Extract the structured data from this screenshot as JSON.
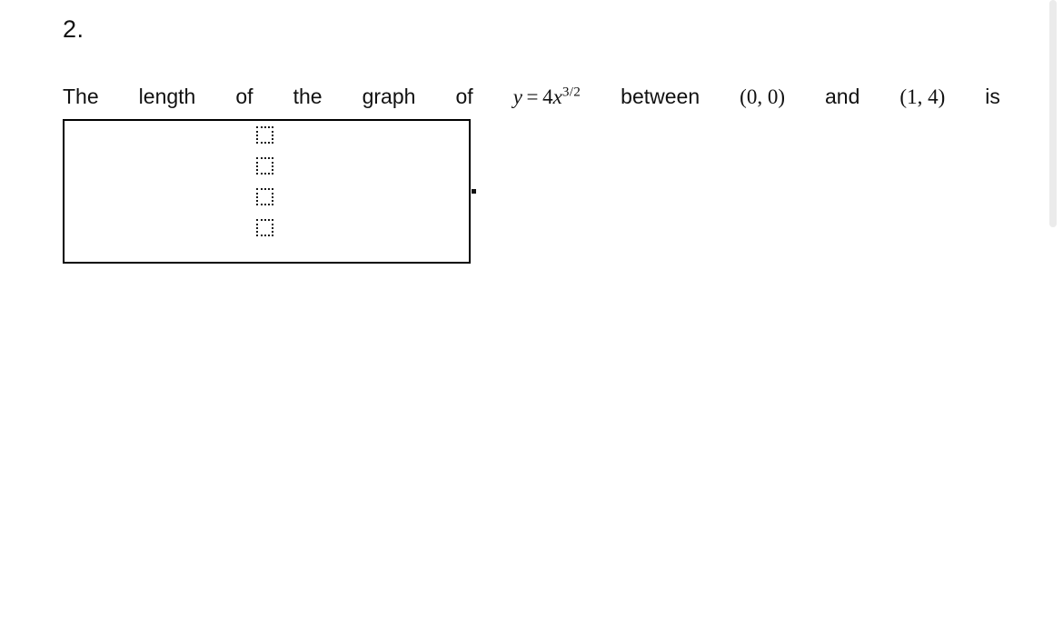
{
  "problem": {
    "number": "2.",
    "question_segments": [
      {
        "kind": "word",
        "text": "The"
      },
      {
        "kind": "word",
        "text": "length"
      },
      {
        "kind": "word",
        "text": "of"
      },
      {
        "kind": "word",
        "text": "the"
      },
      {
        "kind": "word",
        "text": "graph"
      },
      {
        "kind": "word",
        "text": "of"
      },
      {
        "kind": "math",
        "text": "y = 4x^(3/2)"
      },
      {
        "kind": "word",
        "text": "between"
      },
      {
        "kind": "math",
        "text": "(0,0)"
      },
      {
        "kind": "word",
        "text": "and"
      },
      {
        "kind": "math",
        "text": "(1,4)"
      },
      {
        "kind": "word",
        "text": "is"
      }
    ],
    "math": {
      "function_var": "y",
      "equals": "=",
      "coefficient": "4",
      "base_var": "x",
      "exponent": "3/2",
      "point_start": "(0, 0)",
      "point_end": "(1, 4)"
    },
    "words": {
      "the": "The",
      "length": "length",
      "of_1": "of",
      "the_2": "the",
      "graph": "graph",
      "of_2": "of",
      "between": "between",
      "and": "and",
      "is": "is"
    },
    "trailing_punctuation": "."
  },
  "answer_area": {
    "placeholders": [
      {
        "label": ""
      },
      {
        "label": ""
      },
      {
        "label": ""
      },
      {
        "label": ""
      }
    ],
    "border_color": "#000000",
    "background": "#ffffff"
  },
  "scrollbar": {
    "thumb_color": "#ebebeb"
  }
}
